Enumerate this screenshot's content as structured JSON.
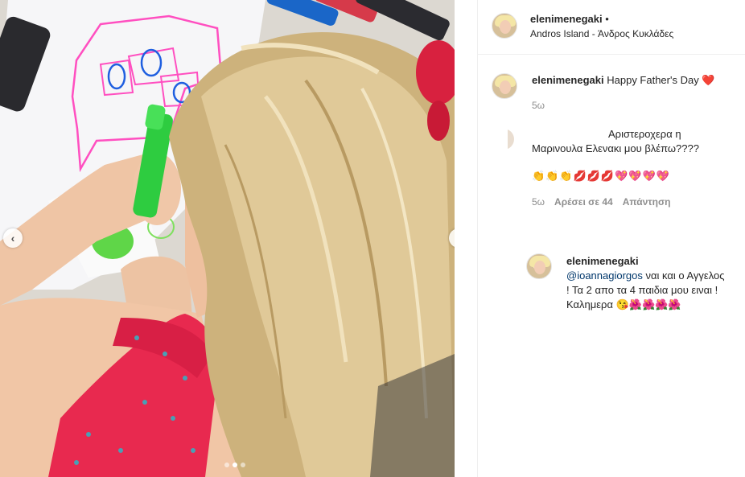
{
  "post": {
    "username": "elenimenegaki",
    "follow_dot": "•",
    "location": "Andros Island - Άνδρος Κυκλάδες"
  },
  "carousel": {
    "prev_icon": "chevron-left-icon",
    "next_icon": "chevron-right-icon",
    "dot_count": 3,
    "active_dot": 1
  },
  "caption": {
    "username": "elenimenegaki",
    "text": "Happy Father's Day",
    "emoji": "❤️",
    "time": "5ω"
  },
  "comments": [
    {
      "text": "Αριστεροχερα η Μαρινουλα Ελενακι μου βλέπω????",
      "emojis": "👏👏👏💋💋💋💖💖💖💖",
      "time": "5ω",
      "likes": "Αρέσει σε 44",
      "reply": "Απάντηση"
    }
  ],
  "reply": {
    "username": "elenimenegaki",
    "mention": "@ioannagiorgos",
    "text": " ναι και ο Αγγελος ! Τα 2 απο τα 4 παιδια μου ειναι ! Καλημερα",
    "emojis": "😘🌺🌺🌺🌺"
  },
  "colors": {
    "mention": "#00376b",
    "muted": "#8e8e8e",
    "heart": "#e0245e"
  }
}
